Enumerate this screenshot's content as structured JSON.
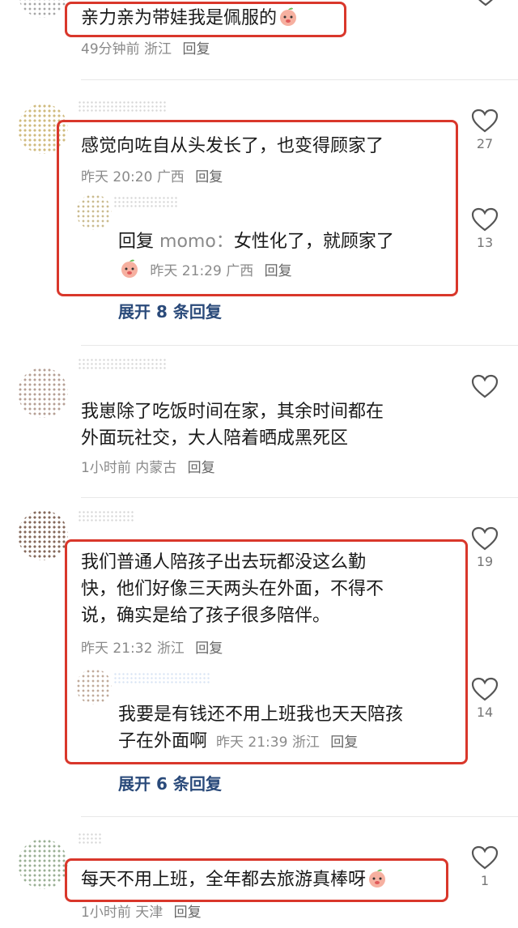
{
  "comments": [
    {
      "text": "亲力亲为带娃我是佩服的",
      "meta": {
        "time": "49分钟前",
        "location": "浙江",
        "reply": "回复"
      }
    },
    {
      "text": "感觉向咗自从头发长了，也变得顾家了",
      "meta": {
        "time": "昨天 20:20",
        "location": "广西",
        "reply": "回复"
      },
      "likes": "27",
      "sub_reply": {
        "prefix": "回复",
        "target": "momo：",
        "text": "女性化了，就顾家了",
        "meta": {
          "time": "昨天 21:29",
          "location": "广西",
          "reply": "回复"
        },
        "likes": "13"
      },
      "expand": "展开 8 条回复"
    },
    {
      "text_line1": "我崽除了吃饭时间在家，其余时间都在",
      "text_line2": "外面玩社交，大人陪着晒成黑死区",
      "meta": {
        "time": "1小时前",
        "location": "内蒙古",
        "reply": "回复"
      }
    },
    {
      "text_line1": "我们普通人陪孩子出去玩都没这么勤",
      "text_line2": "快，他们好像三天两头在外面，不得不",
      "text_line3": "说，确实是给了孩子很多陪伴。",
      "meta": {
        "time": "昨天 21:32",
        "location": "浙江",
        "reply": "回复"
      },
      "likes": "19",
      "sub_reply": {
        "text_line1": "我要是有钱还不用上班我也天天陪孩",
        "text_line2": "子在外面啊",
        "meta": {
          "time": "昨天 21:39",
          "location": "浙江",
          "reply": "回复"
        },
        "likes": "14"
      },
      "expand": "展开 6 条回复"
    },
    {
      "text": "每天不用上班，全年都去旅游真棒呀",
      "meta": {
        "time": "1小时前",
        "location": "天津",
        "reply": "回复"
      },
      "likes": "1"
    }
  ],
  "colors": {
    "highlight_box": "#d9372b",
    "expand_link": "#2a4a7a",
    "meta": "#8a8a8a"
  },
  "icons": {
    "like": "heart-outline-icon",
    "emoji": "peach-emoji-icon"
  }
}
